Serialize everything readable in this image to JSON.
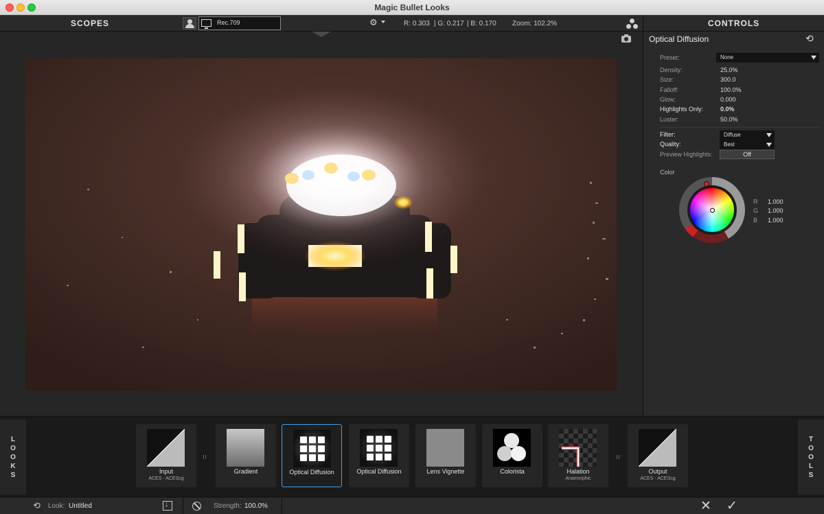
{
  "window": {
    "title": "Magic Bullet Looks"
  },
  "toolbar": {
    "scopes_label": "SCOPES",
    "display_profile": "Rec.709",
    "readout_r": "R: 0.303",
    "readout_g": "| G: 0.217",
    "readout_b": "| B: 0.170",
    "zoom": "Zoom:  102.2%",
    "controls_label": "CONTROLS"
  },
  "controls": {
    "title": "Optical Diffusion",
    "preset_label": "Preset:",
    "preset_value": "None",
    "params": [
      {
        "label": "Density:",
        "value": "25.0%"
      },
      {
        "label": "Size:",
        "value": "300.0"
      },
      {
        "label": "Falloff:",
        "value": "100.0%"
      },
      {
        "label": "Glow:",
        "value": "0.000"
      },
      {
        "label": "Highlights Only:",
        "value": "0.0%"
      },
      {
        "label": "Luster:",
        "value": "50.0%"
      }
    ],
    "filter_label": "Filter:",
    "filter_value": "Diffuse",
    "quality_label": "Quality:",
    "quality_value": "Best",
    "preview_label": "Preview Highlights:",
    "preview_value": "Off",
    "color_label": "Color",
    "rgb": [
      {
        "label": "R",
        "value": "1.000"
      },
      {
        "label": "G",
        "value": "1.000"
      },
      {
        "label": "B",
        "value": "1.000"
      }
    ]
  },
  "strip": {
    "looks_tab": [
      "L",
      "O",
      "O",
      "K",
      "S"
    ],
    "tools_tab": [
      "T",
      "O",
      "O",
      "L",
      "S"
    ],
    "tools": [
      {
        "name": "Input",
        "sub": "ACES - ACEScg",
        "thumb": "ramp"
      },
      {
        "name": "Gradient",
        "sub": "",
        "thumb": "gradient"
      },
      {
        "name": "Optical Diffusion",
        "sub": "",
        "thumb": "grid-glow",
        "selected": true
      },
      {
        "name": "Optical Diffusion",
        "sub": "",
        "thumb": "grid"
      },
      {
        "name": "Lens Vignette",
        "sub": "",
        "thumb": "vignette"
      },
      {
        "name": "Colorista",
        "sub": "",
        "thumb": "circles"
      },
      {
        "name": "Halation",
        "sub": "Anamorphic",
        "thumb": "halation"
      },
      {
        "name": "Output",
        "sub": "ACES - ACEScg",
        "thumb": "ramp"
      }
    ]
  },
  "status": {
    "look_label": "Look:",
    "look_value": "Untitled",
    "strength_label": "Strength:",
    "strength_value": "100.0%"
  }
}
